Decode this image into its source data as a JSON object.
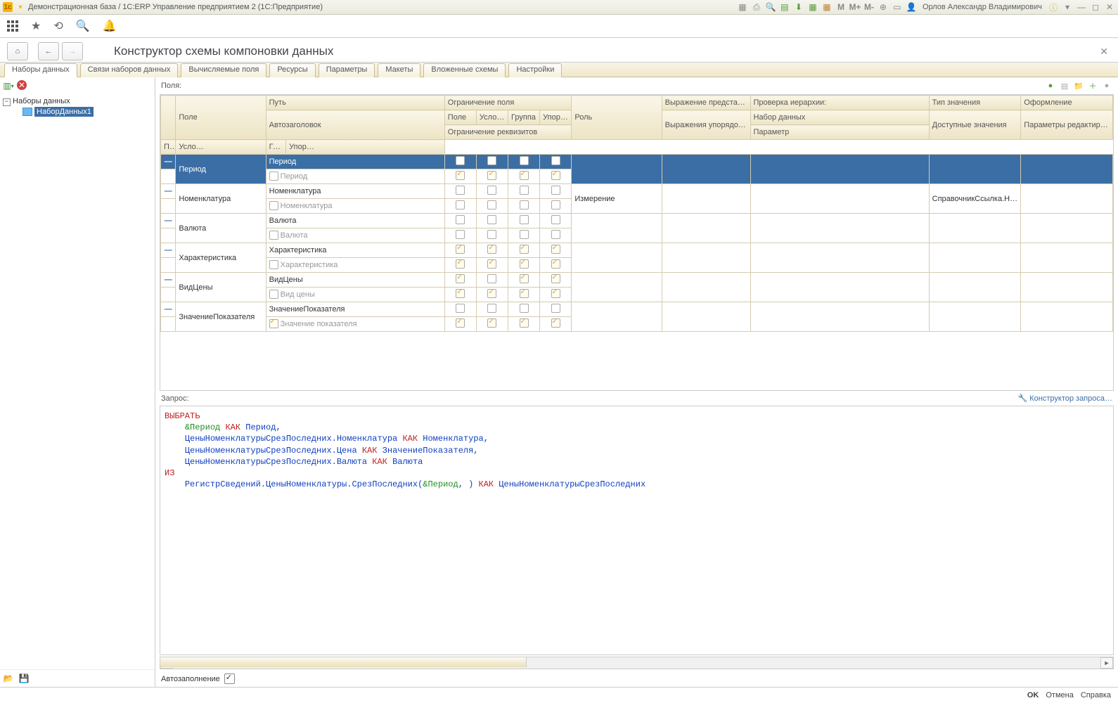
{
  "titlebar": {
    "title": "Демонстрационная база / 1С:ERP Управление предприятием 2  (1С:Предприятие)",
    "user": "Орлов Александр Владимирович",
    "m_labels": [
      "M",
      "M+",
      "M-"
    ]
  },
  "page": {
    "title": "Конструктор схемы компоновки данных"
  },
  "tabs": [
    "Наборы данных",
    "Связи наборов данных",
    "Вычисляемые поля",
    "Ресурсы",
    "Параметры",
    "Макеты",
    "Вложенные схемы",
    "Настройки"
  ],
  "left": {
    "root": "Наборы данных",
    "dataset": "НаборДанных1"
  },
  "fields_label": "Поля:",
  "grid": {
    "headers": {
      "field": "Поле",
      "path": "Путь",
      "autoheader": "Автозаголовок",
      "restr_field": "Ограничение поля",
      "restr_attr": "Ограничение реквизитов",
      "c_field": "Поле",
      "c_cond": "Усло…",
      "c_group": "Группа",
      "c_order": "Упор…",
      "role": "Роль",
      "expr_repr": "Выражение представ…",
      "expr_order": "Выражения упорядочивания",
      "check_hier": "Проверка иерархии:",
      "ds": "Набор данных",
      "param": "Параметр",
      "valtype": "Тип значения",
      "avail": "Доступные значения",
      "design": "Оформление",
      "editparam": "Параметры редактирования"
    },
    "rows": [
      {
        "field": "Период",
        "path": "Период",
        "auto": "Период",
        "l1": [
          0,
          0,
          0,
          0
        ],
        "l2": [
          1,
          1,
          1,
          1
        ],
        "role": "",
        "valtype": "",
        "sel": true,
        "autochk": false
      },
      {
        "field": "Номенклатура",
        "path": "Номенклатура",
        "auto": "Номенклатура",
        "l1": [
          0,
          0,
          0,
          0
        ],
        "l2": [
          0,
          0,
          0,
          0
        ],
        "role": "Измерение",
        "valtype": "СправочникСсылка.Н…",
        "autochk": false
      },
      {
        "field": "Валюта",
        "path": "Валюта",
        "auto": "Валюта",
        "l1": [
          0,
          0,
          0,
          0
        ],
        "l2": [
          0,
          0,
          0,
          0
        ],
        "role": "",
        "valtype": "",
        "autochk": false
      },
      {
        "field": "Характеристика",
        "path": "Характеристика",
        "auto": "Характеристика",
        "l1": [
          1,
          1,
          1,
          1
        ],
        "l2": [
          1,
          1,
          1,
          1
        ],
        "role": "",
        "valtype": "",
        "autochk": false
      },
      {
        "field": "ВидЦены",
        "path": "ВидЦены",
        "auto": "Вид цены",
        "l1": [
          1,
          0,
          1,
          1
        ],
        "l2": [
          1,
          1,
          1,
          1
        ],
        "role": "",
        "valtype": "",
        "autochk": false
      },
      {
        "field": "ЗначениеПоказателя",
        "path": "ЗначениеПоказателя",
        "auto": "Значение показателя",
        "l1": [
          0,
          0,
          0,
          0
        ],
        "l2": [
          1,
          1,
          1,
          1
        ],
        "role": "",
        "valtype": "",
        "autochk": true
      }
    ]
  },
  "query": {
    "label": "Запрос:",
    "constructor_btn": "Конструктор запроса…"
  },
  "autofill": {
    "label": "Автозаполнение",
    "checked": true
  },
  "footer": {
    "ok": "OK",
    "cancel": "Отмена",
    "help": "Справка"
  }
}
